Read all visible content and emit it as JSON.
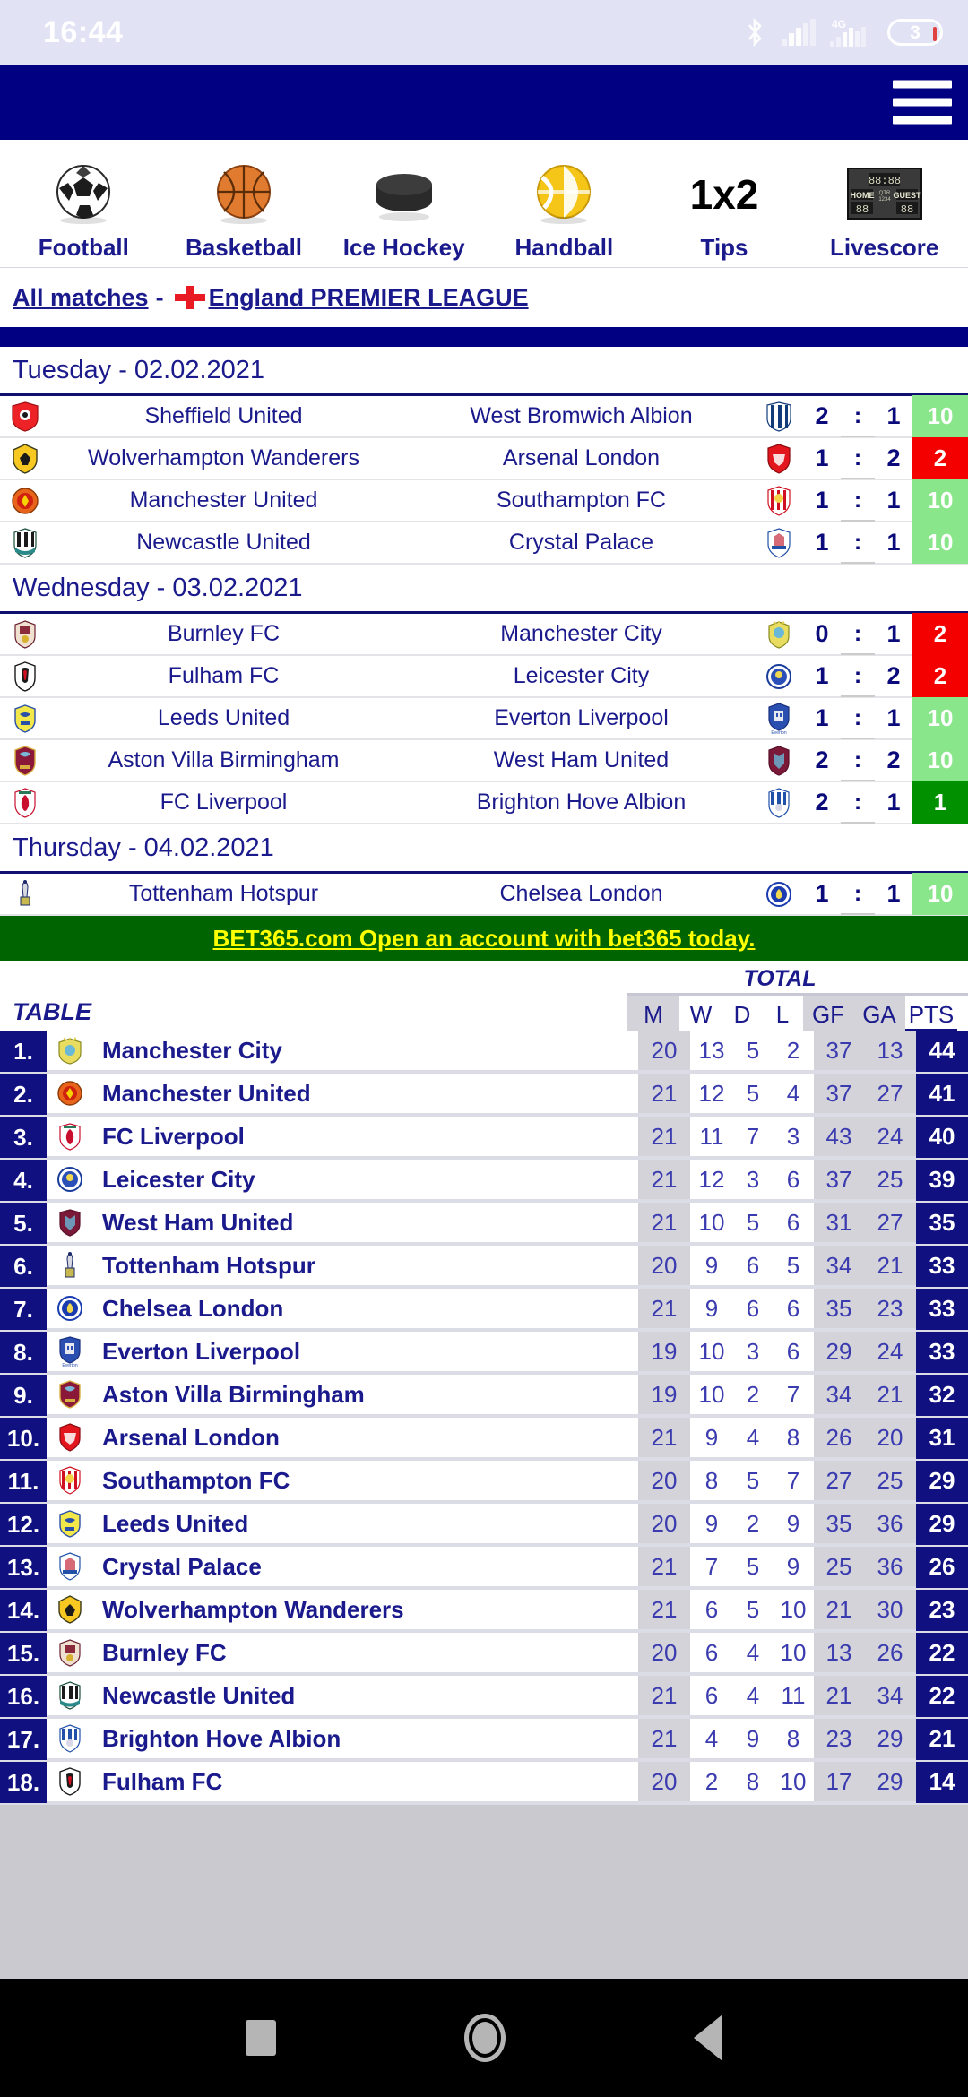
{
  "status_bar": {
    "time": "16:44",
    "battery_level": "3",
    "network": "4G",
    "icons": [
      "bluetooth-icon",
      "signal-bars-icon",
      "4g-signal-icon",
      "battery-icon"
    ]
  },
  "app_header": {
    "menu_icon": "hamburger-menu-icon"
  },
  "sports_nav": [
    {
      "label": "Football",
      "icon": "soccer-ball-icon"
    },
    {
      "label": "Basketball",
      "icon": "basketball-icon"
    },
    {
      "label": "Ice Hockey",
      "icon": "hockey-puck-icon"
    },
    {
      "label": "Handball",
      "icon": "handball-icon"
    },
    {
      "label": "Tips",
      "icon": "1x2-icon"
    },
    {
      "label": "Livescore",
      "icon": "scoreboard-icon"
    }
  ],
  "breadcrumb": {
    "all_matches": "All matches",
    "separator": "-",
    "flag": "england-flag-icon",
    "league": "England PREMIER LEAGUE"
  },
  "match_days": [
    {
      "title": "Tuesday - 02.02.2021",
      "matches": [
        {
          "home": "Sheffield United",
          "away": "West Bromwich Albion",
          "home_score": "2",
          "away_score": "1",
          "odds": "10",
          "odds_color": "green"
        },
        {
          "home": "Wolverhampton Wanderers",
          "away": "Arsenal London",
          "home_score": "1",
          "away_score": "2",
          "odds": "2",
          "odds_color": "red"
        },
        {
          "home": "Manchester United",
          "away": "Southampton FC",
          "home_score": "1",
          "away_score": "1",
          "odds": "10",
          "odds_color": "green"
        },
        {
          "home": "Newcastle United",
          "away": "Crystal Palace",
          "home_score": "1",
          "away_score": "1",
          "odds": "10",
          "odds_color": "green"
        }
      ]
    },
    {
      "title": "Wednesday - 03.02.2021",
      "matches": [
        {
          "home": "Burnley FC",
          "away": "Manchester City",
          "home_score": "0",
          "away_score": "1",
          "odds": "2",
          "odds_color": "red"
        },
        {
          "home": "Fulham FC",
          "away": "Leicester City",
          "home_score": "1",
          "away_score": "2",
          "odds": "2",
          "odds_color": "red"
        },
        {
          "home": "Leeds United",
          "away": "Everton Liverpool",
          "home_score": "1",
          "away_score": "1",
          "odds": "10",
          "odds_color": "green"
        },
        {
          "home": "Aston Villa Birmingham",
          "away": "West Ham United",
          "home_score": "2",
          "away_score": "2",
          "odds": "10",
          "odds_color": "green"
        },
        {
          "home": "FC Liverpool",
          "away": "Brighton Hove Albion",
          "home_score": "2",
          "away_score": "1",
          "odds": "1",
          "odds_color": "dgreen"
        }
      ]
    },
    {
      "title": "Thursday - 04.02.2021",
      "matches": [
        {
          "home": "Tottenham Hotspur",
          "away": "Chelsea London",
          "home_score": "1",
          "away_score": "1",
          "odds": "10",
          "odds_color": "green"
        }
      ]
    }
  ],
  "bet_banner": {
    "text": "BET365.com Open an account with bet365 today."
  },
  "standings": {
    "table_label": "TABLE",
    "group_header": "TOTAL",
    "columns": [
      "M",
      "W",
      "D",
      "L",
      "GF",
      "GA",
      "PTS"
    ],
    "rows": [
      {
        "rank": "1.",
        "team": "Manchester City",
        "m": "20",
        "w": "13",
        "d": "5",
        "l": "2",
        "gf": "37",
        "ga": "13",
        "pts": "44"
      },
      {
        "rank": "2.",
        "team": "Manchester United",
        "m": "21",
        "w": "12",
        "d": "5",
        "l": "4",
        "gf": "37",
        "ga": "27",
        "pts": "41"
      },
      {
        "rank": "3.",
        "team": "FC Liverpool",
        "m": "21",
        "w": "11",
        "d": "7",
        "l": "3",
        "gf": "43",
        "ga": "24",
        "pts": "40"
      },
      {
        "rank": "4.",
        "team": "Leicester City",
        "m": "21",
        "w": "12",
        "d": "3",
        "l": "6",
        "gf": "37",
        "ga": "25",
        "pts": "39"
      },
      {
        "rank": "5.",
        "team": "West Ham United",
        "m": "21",
        "w": "10",
        "d": "5",
        "l": "6",
        "gf": "31",
        "ga": "27",
        "pts": "35"
      },
      {
        "rank": "6.",
        "team": "Tottenham Hotspur",
        "m": "20",
        "w": "9",
        "d": "6",
        "l": "5",
        "gf": "34",
        "ga": "21",
        "pts": "33"
      },
      {
        "rank": "7.",
        "team": "Chelsea London",
        "m": "21",
        "w": "9",
        "d": "6",
        "l": "6",
        "gf": "35",
        "ga": "23",
        "pts": "33"
      },
      {
        "rank": "8.",
        "team": "Everton Liverpool",
        "m": "19",
        "w": "10",
        "d": "3",
        "l": "6",
        "gf": "29",
        "ga": "24",
        "pts": "33"
      },
      {
        "rank": "9.",
        "team": "Aston Villa Birmingham",
        "m": "19",
        "w": "10",
        "d": "2",
        "l": "7",
        "gf": "34",
        "ga": "21",
        "pts": "32"
      },
      {
        "rank": "10.",
        "team": "Arsenal London",
        "m": "21",
        "w": "9",
        "d": "4",
        "l": "8",
        "gf": "26",
        "ga": "20",
        "pts": "31"
      },
      {
        "rank": "11.",
        "team": "Southampton FC",
        "m": "20",
        "w": "8",
        "d": "5",
        "l": "7",
        "gf": "27",
        "ga": "25",
        "pts": "29"
      },
      {
        "rank": "12.",
        "team": "Leeds United",
        "m": "20",
        "w": "9",
        "d": "2",
        "l": "9",
        "gf": "35",
        "ga": "36",
        "pts": "29"
      },
      {
        "rank": "13.",
        "team": "Crystal Palace",
        "m": "21",
        "w": "7",
        "d": "5",
        "l": "9",
        "gf": "25",
        "ga": "36",
        "pts": "26"
      },
      {
        "rank": "14.",
        "team": "Wolverhampton Wanderers",
        "m": "21",
        "w": "6",
        "d": "5",
        "l": "10",
        "gf": "21",
        "ga": "30",
        "pts": "23"
      },
      {
        "rank": "15.",
        "team": "Burnley FC",
        "m": "20",
        "w": "6",
        "d": "4",
        "l": "10",
        "gf": "13",
        "ga": "26",
        "pts": "22"
      },
      {
        "rank": "16.",
        "team": "Newcastle United",
        "m": "21",
        "w": "6",
        "d": "4",
        "l": "11",
        "gf": "21",
        "ga": "34",
        "pts": "22"
      },
      {
        "rank": "17.",
        "team": "Brighton Hove Albion",
        "m": "21",
        "w": "4",
        "d": "9",
        "l": "8",
        "gf": "23",
        "ga": "29",
        "pts": "21"
      },
      {
        "rank": "18.",
        "team": "Fulham FC",
        "m": "20",
        "w": "2",
        "d": "8",
        "l": "10",
        "gf": "17",
        "ga": "29",
        "pts": "14"
      }
    ]
  },
  "android_nav": {
    "recents": "square-recents-icon",
    "home": "circle-home-icon",
    "back": "triangle-back-icon"
  }
}
